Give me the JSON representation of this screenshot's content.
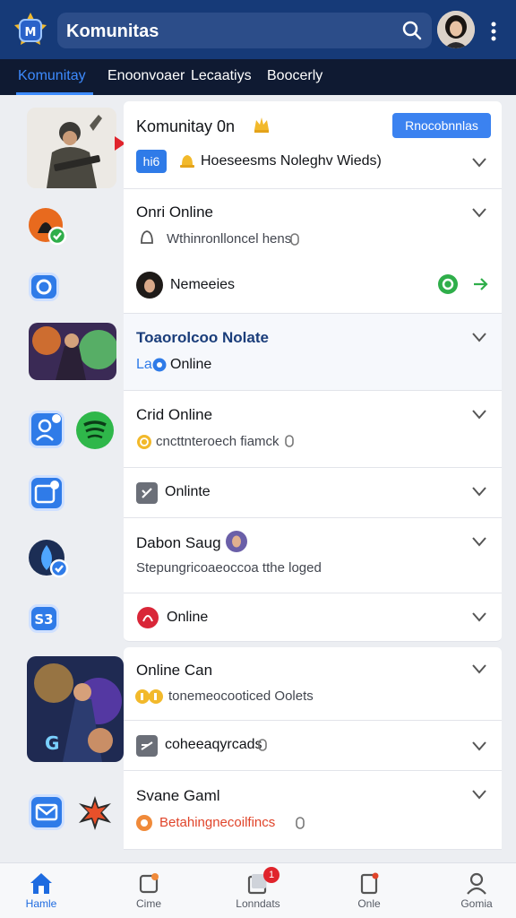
{
  "header": {
    "search_title": "Komunitas"
  },
  "tabs": [
    {
      "label": "Komunitay"
    },
    {
      "label": "Enoonvoaer"
    },
    {
      "label": "Lecaatiys"
    },
    {
      "label": "Boocerly"
    }
  ],
  "cards": {
    "c1": {
      "title": "Komunitay 0n",
      "button": "Rnocobnnlas",
      "tag": "hi6",
      "line": "Hoeseesms Noleghv Wieds)"
    },
    "c2": {
      "title": "Onri Online",
      "sub": "Wthinronlloncel hens",
      "member": "Nemeeies"
    },
    "c3": {
      "title": "Toaorolcoo Nolate",
      "tag": "La",
      "status": "Online"
    },
    "c4": {
      "title": "Crid Online",
      "sub": "cncttnteroech fiamck"
    },
    "c5": {
      "status": "Onlinte"
    },
    "c6": {
      "title": "Dabon Saug",
      "sub": "Stepungricoaeoccoa tthe loged"
    },
    "c7": {
      "status": "Online"
    },
    "c8": {
      "title": "Online Can",
      "sub": "tonemeocooticed Oolets"
    },
    "c9": {
      "label": "coheeaqyrcads"
    },
    "c10": {
      "title": "Svane Gaml",
      "sub": "Betahingnecoilfincs"
    }
  },
  "bottom_nav": [
    {
      "label": "Hamle",
      "icon": "home-icon",
      "active": true
    },
    {
      "label": "Cime",
      "icon": "game-icon",
      "active": false
    },
    {
      "label": "Lonndats",
      "icon": "inbox-icon",
      "active": false,
      "badge": "1"
    },
    {
      "label": "Onle",
      "icon": "notes-icon",
      "active": false
    },
    {
      "label": "Gomia",
      "icon": "profile-icon",
      "active": false
    }
  ],
  "colors": {
    "header_bg": "#163a78",
    "tabbar_bg": "#0f1a32",
    "accent": "#3d8bff",
    "button_blue": "#3b82f0",
    "online_green": "#2fae4a"
  }
}
